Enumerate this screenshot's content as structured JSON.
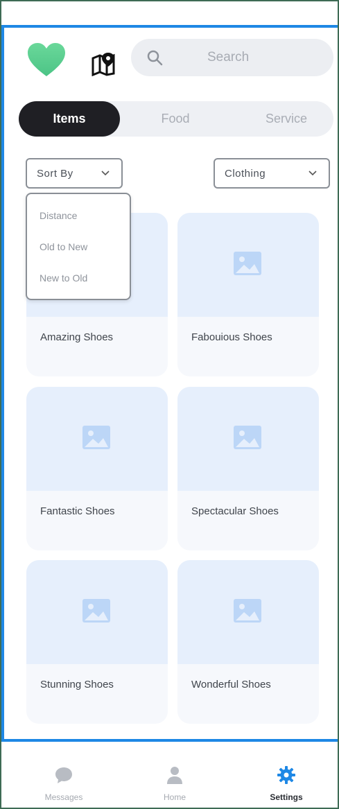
{
  "search": {
    "placeholder": "Search"
  },
  "tabs": [
    {
      "label": "Items",
      "active": true
    },
    {
      "label": "Food",
      "active": false
    },
    {
      "label": "Service",
      "active": false
    }
  ],
  "filters": {
    "sort": {
      "label": "Sort By",
      "open": true,
      "options": [
        "Distance",
        "Old to New",
        "New to Old"
      ]
    },
    "category": {
      "label": "Clothing"
    }
  },
  "products": [
    {
      "title": "Amazing Shoes"
    },
    {
      "title": "Fabouious Shoes"
    },
    {
      "title": "Fantastic Shoes"
    },
    {
      "title": "Spectacular Shoes"
    },
    {
      "title": "Stunning Shoes"
    },
    {
      "title": "Wonderful Shoes"
    }
  ],
  "bottom_nav": [
    {
      "label": "Messages",
      "icon": "chat-bubble-icon",
      "active": false
    },
    {
      "label": "Home",
      "icon": "person-icon",
      "active": false
    },
    {
      "label": "Settings",
      "icon": "gear-icon",
      "active": true
    }
  ],
  "colors": {
    "accent": "#1e88e5",
    "heart": "#5fd08e",
    "dark_tab": "#1f1f24",
    "image_placeholder": "#e6effc"
  }
}
